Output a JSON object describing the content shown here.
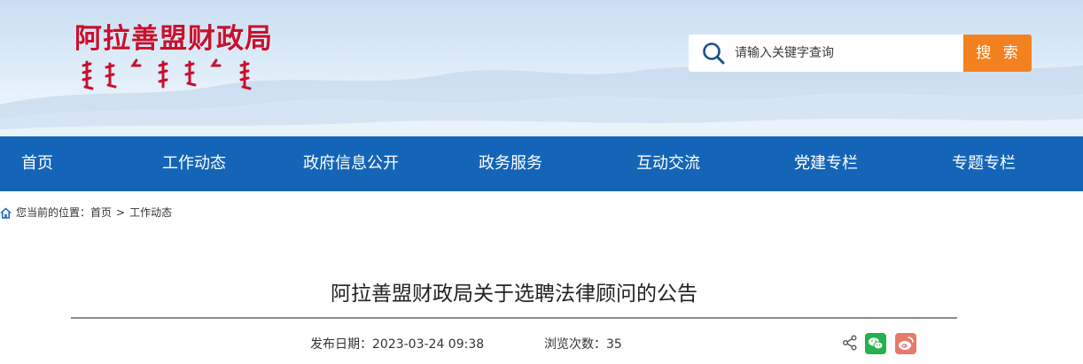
{
  "header": {
    "site_title": "阿拉善盟财政局",
    "search_placeholder": "请输入关键字查询",
    "search_button": "搜 索"
  },
  "nav": {
    "items": [
      {
        "label": "首页"
      },
      {
        "label": "工作动态"
      },
      {
        "label": "政府信息公开"
      },
      {
        "label": "政务服务"
      },
      {
        "label": "互动交流"
      },
      {
        "label": "党建专栏"
      },
      {
        "label": "专题专栏"
      }
    ]
  },
  "breadcrumb": {
    "prefix": "您当前的位置：",
    "home": "首页",
    "separator": ">",
    "current": "工作动态"
  },
  "article": {
    "title": "阿拉善盟财政局关于选聘法律顾问的公告",
    "publish_date_label": "发布日期：",
    "publish_date": "2023-03-24 09:38",
    "views_label": "浏览次数：",
    "views": "35"
  },
  "colors": {
    "title_red": "#c8102e",
    "nav_blue": "#1465b7",
    "search_orange": "#f4811f",
    "wechat_green": "#22b14c",
    "weibo_red": "#e8786a"
  },
  "icons": [
    "search-icon",
    "home-icon",
    "share-icon",
    "wechat-icon",
    "weibo-icon"
  ]
}
